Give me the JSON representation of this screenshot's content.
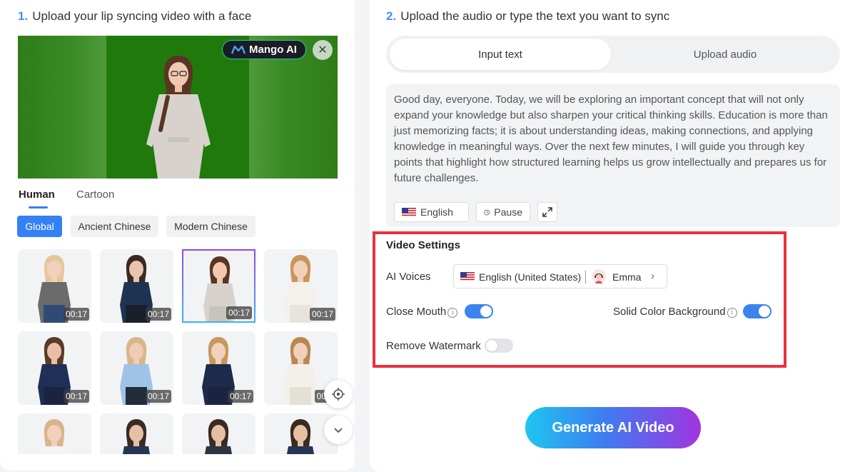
{
  "left": {
    "step_number": "1.",
    "step_title": "Upload your lip syncing video with a face",
    "brand_label": "Mango AI",
    "type_tabs": [
      {
        "label": "Human",
        "active": true
      },
      {
        "label": "Cartoon",
        "active": false
      }
    ],
    "category_chips": [
      {
        "label": "Global",
        "active": true
      },
      {
        "label": "Ancient Chinese",
        "active": false
      },
      {
        "label": "Modern Chinese",
        "active": false
      }
    ],
    "avatars": [
      {
        "duration": "00:17",
        "selected": false
      },
      {
        "duration": "00:17",
        "selected": false
      },
      {
        "duration": "00:17",
        "selected": true
      },
      {
        "duration": "00:17",
        "selected": false
      },
      {
        "duration": "00:17",
        "selected": false
      },
      {
        "duration": "00:17",
        "selected": false
      },
      {
        "duration": "00:17",
        "selected": false
      },
      {
        "duration": "00:1",
        "selected": false
      },
      {
        "duration": "",
        "selected": false
      },
      {
        "duration": "",
        "selected": false
      },
      {
        "duration": "",
        "selected": false
      },
      {
        "duration": "",
        "selected": false
      }
    ]
  },
  "right": {
    "step_number": "2.",
    "step_title": "Upload the audio or type the text you want to sync",
    "mode_tabs": {
      "active_label": "Input text",
      "inactive_label": "Upload audio"
    },
    "script_text": "Good day, everyone. Today, we will be exploring an important concept that will not only expand your knowledge but also sharpen your critical thinking skills. Education is more than just memorizing facts; it is about understanding ideas, making connections, and applying knowledge in meaningful ways. Over the next few minutes, I will guide you through key points that highlight how structured learning helps us grow intellectually and prepares us for future challenges.",
    "language_button": "English",
    "pause_button": "Pause",
    "settings": {
      "title": "Video Settings",
      "ai_voices_label": "AI Voices",
      "voice_language": "English (United States)",
      "voice_name": "Emma",
      "close_mouth_label": "Close Mouth",
      "close_mouth_on": true,
      "solid_bg_label": "Solid Color Background",
      "solid_bg_on": true,
      "remove_watermark_label": "Remove Watermark",
      "remove_watermark_on": false
    },
    "generate_button": "Generate AI Video"
  },
  "colors": {
    "accent_blue": "#3381f5",
    "highlight_red": "#e8323c",
    "green_screen": "#2a7d12"
  }
}
